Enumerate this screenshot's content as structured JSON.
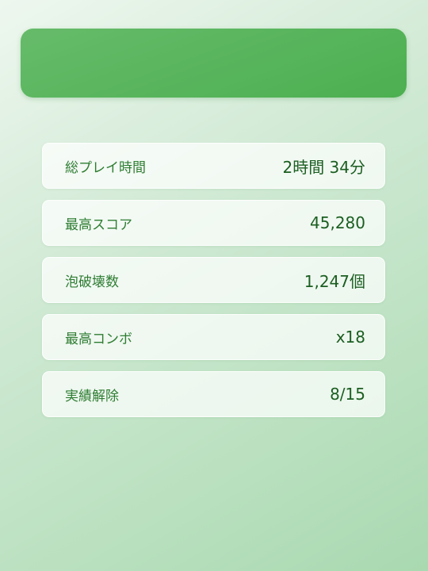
{
  "header": {
    "title": ""
  },
  "stats": [
    {
      "label": "総プレイ時間",
      "value": "2時間 34分"
    },
    {
      "label": "最高スコア",
      "value": "45,280"
    },
    {
      "label": "泡破壊数",
      "value": "1,247個"
    },
    {
      "label": "最高コンボ",
      "value": "x18"
    },
    {
      "label": "実績解除",
      "value": "8/15"
    }
  ],
  "colors": {
    "accent": "#4caf50",
    "label_text": "#2e7d32",
    "value_text": "#1b5e20"
  }
}
